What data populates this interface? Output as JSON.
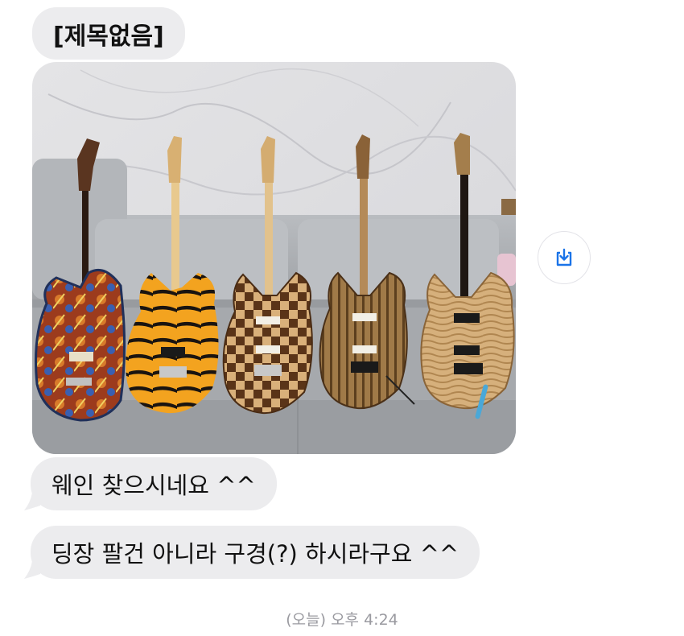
{
  "conversation": {
    "title_bubble": "[제목없음]",
    "photo": {
      "alt": "Five electric guitars on a grey sofa",
      "guitars": [
        {
          "finish": "floral-graphic",
          "color": "#8a3a1e"
        },
        {
          "finish": "tiger-stripe",
          "color": "#f0a420"
        },
        {
          "finish": "checkerboard",
          "color": "#b5814a"
        },
        {
          "finish": "zebrawood",
          "color": "#9a7040"
        },
        {
          "finish": "flame-maple",
          "color": "#c9a16a"
        }
      ]
    },
    "messages": [
      {
        "text": "웨인 찾으시네요 ^^"
      },
      {
        "text": "딩장 팔건 아니라 구경(?) 하시라구요 ^^"
      }
    ],
    "timestamp": "(오늘) 오후 4:24"
  },
  "actions": {
    "save_icon": "download-icon",
    "accent_color": "#1a73e8"
  },
  "colors": {
    "bubble_bg": "#ececee",
    "timestamp_text": "#9a9aa0"
  }
}
